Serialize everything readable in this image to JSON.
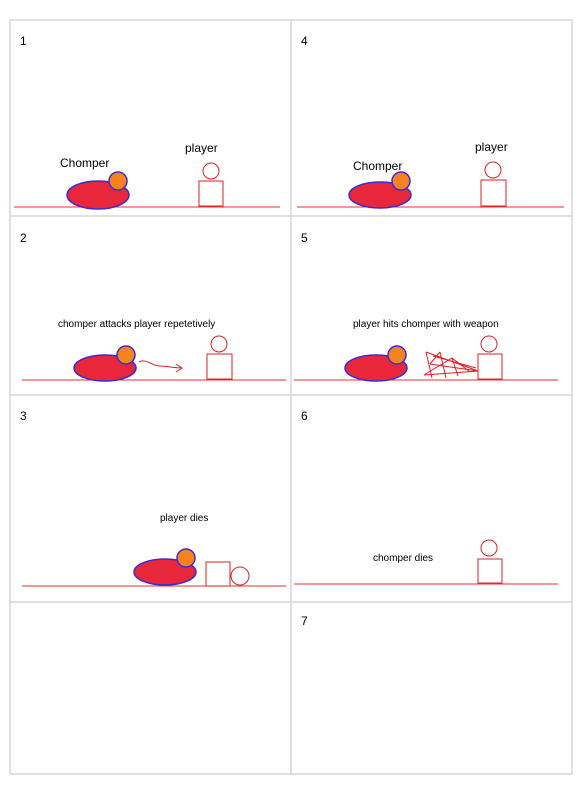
{
  "colors": {
    "grid": "#d6d6d6",
    "ground": "#e8302f",
    "body_fill": "#e8283a",
    "body_stroke": "#3b2ad9",
    "head_fill": "#f7831e",
    "player_stroke": "#e01f26"
  },
  "panels": [
    {
      "number": "1",
      "chomper_label": "Chomper",
      "player_label": "player"
    },
    {
      "number": "2",
      "caption": "chomper attacks player repetetively"
    },
    {
      "number": "3",
      "caption": "player dies"
    },
    {
      "number": "",
      "caption": ""
    },
    {
      "number": "4",
      "chomper_label": "Chomper",
      "player_label": "player"
    },
    {
      "number": "5",
      "caption": "player hits chomper with weapon"
    },
    {
      "number": "6",
      "caption": "chomper dies"
    },
    {
      "number": "7",
      "caption": ""
    }
  ]
}
